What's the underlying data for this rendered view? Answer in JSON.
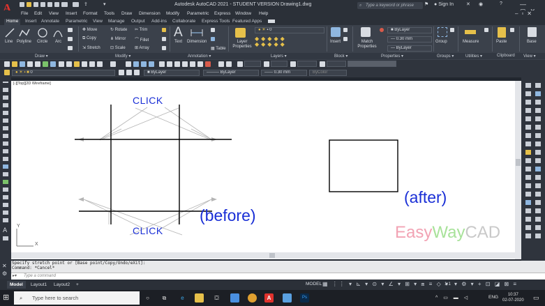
{
  "titlebar": {
    "logo": "A",
    "title": "Autodesk AutoCAD 2021 - STUDENT VERSION    Drawing1.dwg",
    "search_placeholder": "Type a keyword or phrase",
    "signin": "Sign In"
  },
  "menu": [
    "File",
    "Edit",
    "View",
    "Insert",
    "Format",
    "Tools",
    "Draw",
    "Dimension",
    "Modify",
    "Parametric",
    "Express",
    "Window",
    "Help"
  ],
  "ribbon_tabs": [
    "Home",
    "Insert",
    "Annotate",
    "Parametric",
    "View",
    "Manage",
    "Output",
    "Add-ins",
    "Collaborate",
    "Express Tools",
    "Featured Apps"
  ],
  "ribbon": {
    "draw_tools": [
      "Line",
      "Polyline",
      "Circle",
      "Arc"
    ],
    "modify_tools": [
      "Move",
      "Rotate",
      "Trim",
      "Copy",
      "Mirror",
      "Fillet",
      "Stretch",
      "Scale",
      "Array"
    ],
    "annotation_tools": [
      "Text",
      "Dimension",
      "Table"
    ],
    "layers": {
      "layer_props": "Layer Properties",
      "layer_value": "0"
    },
    "block": {
      "insert": "Insert"
    },
    "properties": {
      "match": "Match Properties",
      "color": "ByLayer",
      "lineweight": "0.30 mm",
      "linetype": "ByLayer"
    },
    "groups": {
      "group": "Group"
    },
    "utilities": {
      "measure": "Measure"
    },
    "clipboard": {
      "paste": "Paste"
    },
    "view": {
      "base": "Base"
    },
    "panels": [
      "Draw",
      "Modify",
      "Annotation",
      "Layers",
      "Block",
      "Properties",
      "Groups",
      "Utilities",
      "Clipboard",
      "View"
    ]
  },
  "toolbar2": {
    "layer": "0",
    "color": "ByLayer",
    "linetype": "ByLayer",
    "lineweight": "0.30 mm",
    "plotstyle": "ByColor"
  },
  "canvas": {
    "viewport_label": "[-][Top][2D Wireframe]",
    "click_top": "CLICK",
    "click_bottom": "CLICK",
    "before_label": "(before)",
    "after_label": "(after)",
    "watermark": {
      "easy": "Easy",
      "way": "Way",
      "cad": "CAD"
    },
    "ucs_y": "Y",
    "ucs_x": "X"
  },
  "command": {
    "history_1": "Specify stretch point or [Base point/Copy/Undo/eXit]:",
    "history_2": "Command: *Cancel*",
    "placeholder": "Type a command"
  },
  "layout_tabs": [
    "Model",
    "Layout1",
    "Layout2",
    "+"
  ],
  "status": {
    "model": "MODEL",
    "scale": "1:1"
  },
  "taskbar": {
    "search_placeholder": "Type here to search",
    "lang": "ENG",
    "time": "10:37",
    "date": "02-07-2020"
  },
  "colors": {
    "accent_blue": "#1a2fd6",
    "watermark_pink": "#f2a3b4",
    "watermark_green": "#a8e29a",
    "watermark_gray": "#c9c9c9",
    "autocad_red": "#e0322d"
  }
}
